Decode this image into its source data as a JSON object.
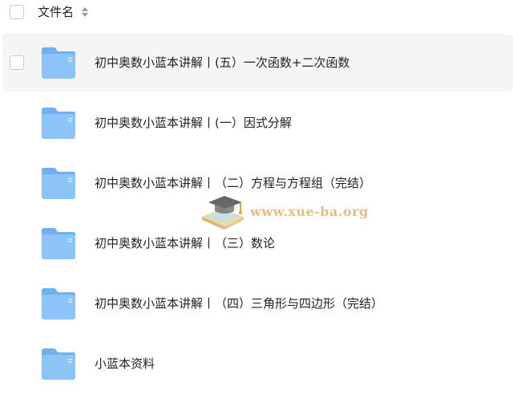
{
  "header": {
    "column_label": "文件名",
    "sort_icon": "sort-updown-icon"
  },
  "rows": [
    {
      "name": "初中奥数小蓝本讲解丨(五）一次函数+二次函数",
      "icon": "folder-icon",
      "hovered": true
    },
    {
      "name": "初中奥数小蓝本讲解丨(一）因式分解",
      "icon": "folder-icon"
    },
    {
      "name": "初中奥数小蓝本讲解丨（二）方程与方程组（完结）",
      "icon": "folder-icon"
    },
    {
      "name": "初中奥数小蓝本讲解丨（三）数论",
      "icon": "folder-icon"
    },
    {
      "name": "初中奥数小蓝本讲解丨（四）三角形与四边形（完结）",
      "icon": "folder-icon"
    },
    {
      "name": "小蓝本资料",
      "icon": "folder-icon"
    }
  ],
  "watermark": {
    "text": "www.xue-ba.org",
    "icon": "graduation-cap-book-icon"
  },
  "colors": {
    "hover_row": "#f5f5f6",
    "folder_body": "#8dc4f7",
    "folder_tab": "#6fb0f0",
    "watermark": "#e7b27a"
  }
}
